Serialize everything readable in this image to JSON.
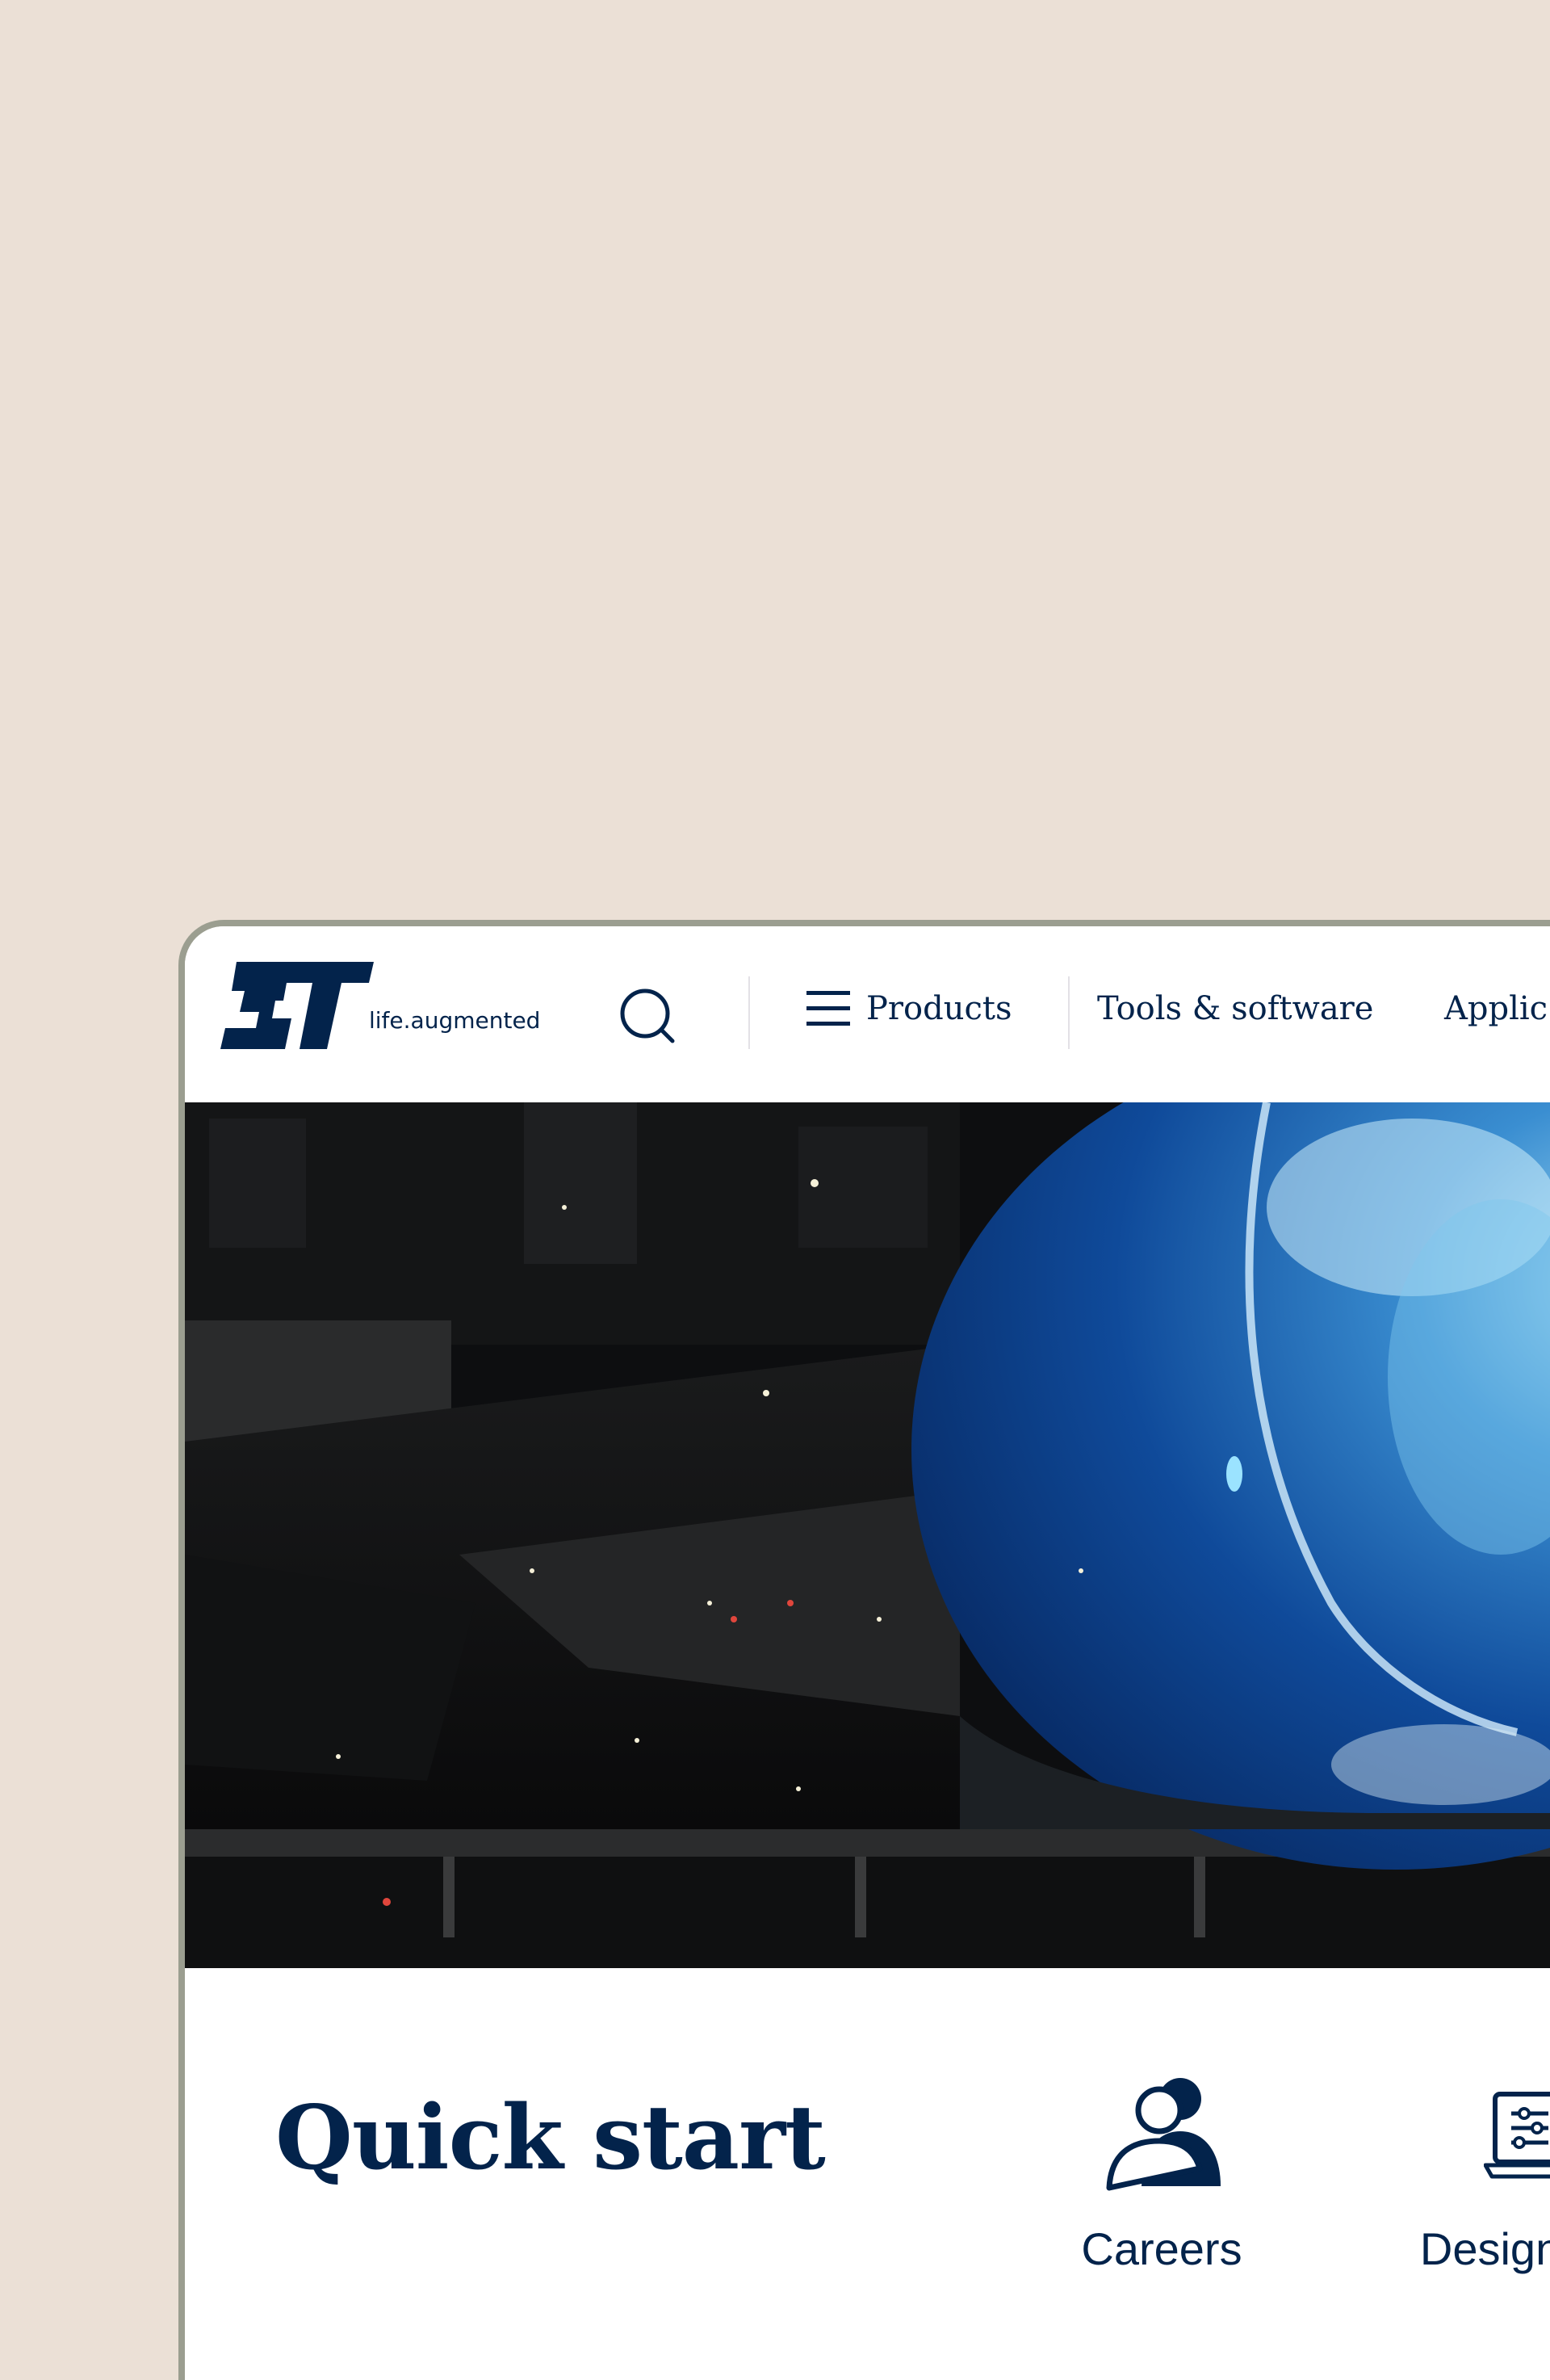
{
  "brand": {
    "logo_text": "ST",
    "tagline": "life.augmented"
  },
  "nav": {
    "search_icon": "search-icon",
    "menu_icon": "hamburger-icon",
    "items": [
      {
        "label": "Products"
      },
      {
        "label": "Tools & software"
      },
      {
        "label": "Applic"
      }
    ]
  },
  "hero": {
    "image": "night aerial view of a city with a large illuminated blue sphere venue"
  },
  "quick_start": {
    "title": "Quick start",
    "items": [
      {
        "label": "Careers",
        "icon": "person-group-icon"
      },
      {
        "label": "Design tools",
        "icon": "laptop-sliders-icon"
      }
    ]
  },
  "colors": {
    "page_background": "#ebe0d6",
    "brand_navy": "#03234b",
    "device_frame": "#9b9e90"
  }
}
